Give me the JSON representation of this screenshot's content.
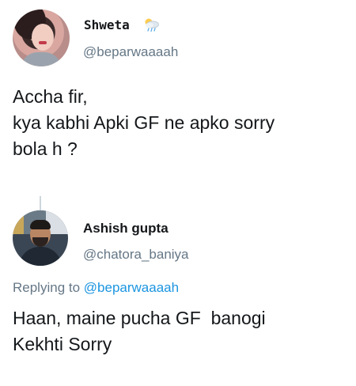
{
  "original_tweet": {
    "name": "Shweta",
    "name_icon": "sun-behind-rain-cloud-icon",
    "handle": "@beparwaaaah",
    "text_lines": [
      "Accha fir,",
      "kya kabhi Apki GF ne apko sorry",
      "bola h ?"
    ]
  },
  "reply_tweet": {
    "name": "Ashish gupta",
    "handle": "@chatora_baniya",
    "replying_prefix": "Replying to",
    "replying_mention": "@beparwaaaah",
    "text_lines": [
      "Haan, maine pucha GF  banogi",
      "Kekhti Sorry"
    ]
  },
  "colors": {
    "text_primary": "#14171a",
    "text_secondary": "#657786",
    "mention": "#1b95e0",
    "thread_line": "#ccd6dd"
  }
}
